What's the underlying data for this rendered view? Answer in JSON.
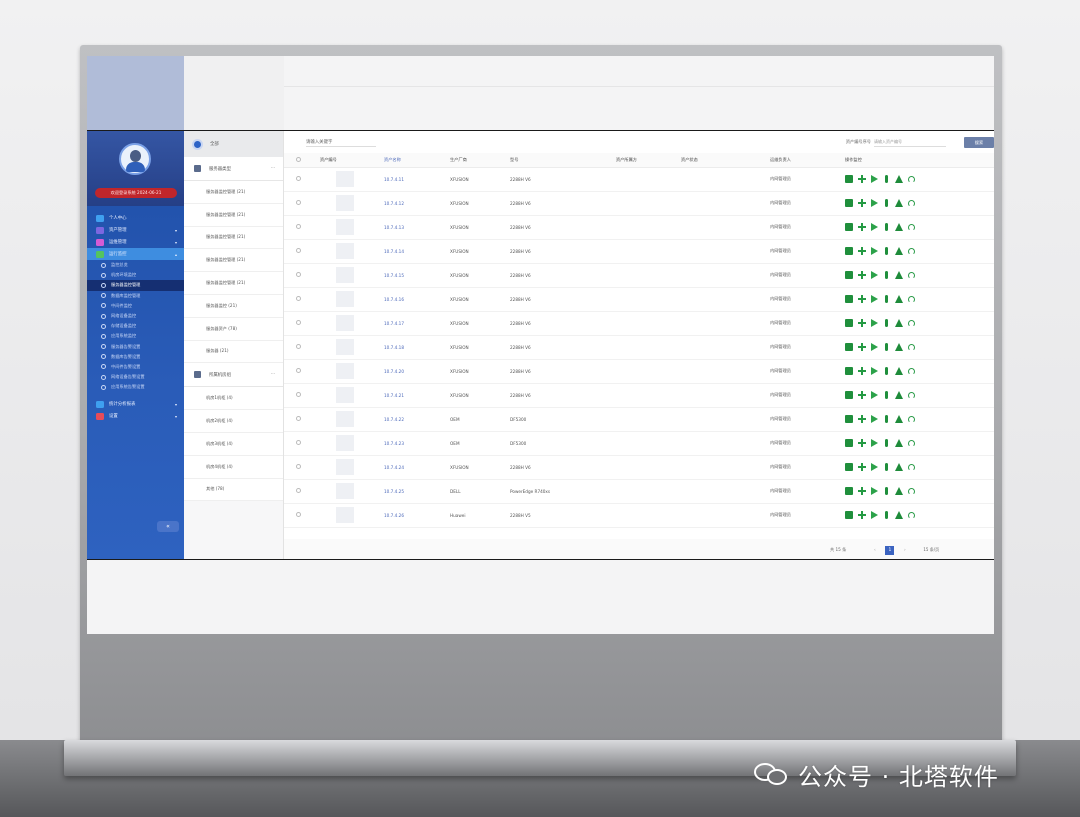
{
  "sidebar": {
    "badge": "欢迎登录系统  2024-06-21",
    "nav_items": [
      {
        "label": "个人中心",
        "color": "#3fa0f0",
        "caret": ""
      },
      {
        "label": "资产管理",
        "color": "#7c67e0",
        "caret": "▾"
      },
      {
        "label": "运维管理",
        "color": "#d55bd5",
        "caret": "▾"
      },
      {
        "label": "运行监控",
        "color": "#54c45e",
        "caret": "▴"
      }
    ],
    "sub_items": [
      "监控总览",
      "机房环境监控",
      "服务器监控管理",
      "数据库监控管理",
      "中间件监控",
      "网络设备监控",
      "存储设备监控",
      "应用系统监控",
      "服务器告警设置",
      "数据库告警设置",
      "中间件告警设置",
      "网络设备告警设置",
      "应用系统告警设置"
    ],
    "bottom_items": [
      {
        "label": "统计分析报表",
        "color": "#3fa0f0",
        "caret": "▾"
      },
      {
        "label": "设置",
        "color": "#e84c5a",
        "caret": "▾"
      }
    ],
    "collapse_label": "«"
  },
  "tree": {
    "all_label": "全部",
    "groups": [
      {
        "label": "服务器类型",
        "items": [
          "服务器监控管理 (21)",
          "服务器监控管理 (21)",
          "服务器监控管理 (21)",
          "服务器监控管理 (21)",
          "服务器监控管理 (21)",
          "服务器监控 (21)",
          "服务器资产 (78)",
          "服务器 (21)"
        ]
      },
      {
        "label": "所属机房组",
        "items": [
          "机房1机柜 (4)",
          "机房2机柜 (4)",
          "机房3机柜 (4)",
          "机房4机柜 (4)",
          "其他 (78)"
        ]
      }
    ],
    "more_label": "···"
  },
  "toolbar": {
    "keyword_label": "请输入关键字",
    "asset_label": "资产编号序号",
    "asset_placeholder": "请输入资产编号",
    "search_label": "搜索"
  },
  "table": {
    "columns": [
      "资产编号",
      "资产名称",
      "生产厂商",
      "型号",
      "资产所属方",
      "资产状态",
      "运维负责人",
      "操作监控"
    ],
    "rows": [
      {
        "ip": "10.7.4.11",
        "vendor": "XFUSION",
        "model": "2288H V6",
        "owner": "内网管理员"
      },
      {
        "ip": "10.7.4.12",
        "vendor": "XFUSION",
        "model": "2288H V6",
        "owner": "内网管理员"
      },
      {
        "ip": "10.7.4.13",
        "vendor": "XFUSION",
        "model": "2288H V6",
        "owner": "内网管理员"
      },
      {
        "ip": "10.7.4.14",
        "vendor": "XFUSION",
        "model": "2288H V6",
        "owner": "内网管理员"
      },
      {
        "ip": "10.7.4.15",
        "vendor": "XFUSION",
        "model": "2288H V6",
        "owner": "内网管理员"
      },
      {
        "ip": "10.7.4.16",
        "vendor": "XFUSION",
        "model": "2288H V6",
        "owner": "内网管理员"
      },
      {
        "ip": "10.7.4.17",
        "vendor": "XFUSION",
        "model": "2288H V6",
        "owner": "内网管理员"
      },
      {
        "ip": "10.7.4.18",
        "vendor": "XFUSION",
        "model": "2288H V6",
        "owner": "内网管理员"
      },
      {
        "ip": "10.7.4.20",
        "vendor": "XFUSION",
        "model": "2288H V6",
        "owner": "内网管理员"
      },
      {
        "ip": "10.7.4.21",
        "vendor": "XFUSION",
        "model": "2288H V6",
        "owner": "内网管理员"
      },
      {
        "ip": "10.7.4.22",
        "vendor": "OEM",
        "model": "DF5300",
        "owner": "内网管理员"
      },
      {
        "ip": "10.7.4.23",
        "vendor": "OEM",
        "model": "DF5300",
        "owner": "内网管理员"
      },
      {
        "ip": "10.7.4.24",
        "vendor": "XFUSION",
        "model": "2288H V6",
        "owner": "内网管理员"
      },
      {
        "ip": "10.7.4.25",
        "vendor": "DELL",
        "model": "PowerEdge R740xs",
        "owner": "内网管理员"
      },
      {
        "ip": "10.7.4.26",
        "vendor": "Huawei",
        "model": "2288H V5",
        "owner": "内网管理员"
      }
    ],
    "op_icons": [
      "monitor-icon",
      "plus-icon",
      "flag-icon",
      "thermometer-icon",
      "alarm-icon",
      "headset-icon"
    ],
    "op_color": "#1f8f3c"
  },
  "footer": {
    "total": "共 15 条",
    "prev": "‹",
    "page": "1",
    "next": "›",
    "per_page": "15 条/页"
  },
  "watermark": {
    "text": "公众号 · 北塔软件",
    "icon": "wechat-icon"
  }
}
